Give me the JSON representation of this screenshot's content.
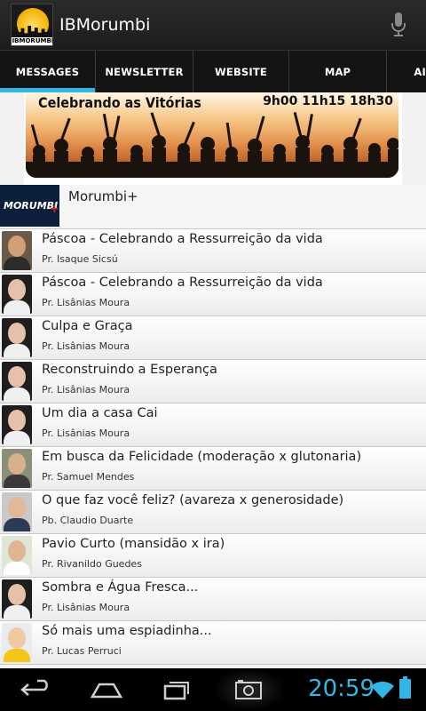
{
  "app": {
    "title": "IBMorumbi",
    "logo_text": "IBMORUMBI"
  },
  "tabs": [
    {
      "label": "MESSAGES",
      "active": true
    },
    {
      "label": "NEWSLETTER",
      "active": false
    },
    {
      "label": "WEBSITE",
      "active": false
    },
    {
      "label": "MAP",
      "active": false
    },
    {
      "label": "AI",
      "active": false
    }
  ],
  "banner": {
    "title": "Celebrando as Vitórias",
    "times": "9h00 11h15 18h30"
  },
  "featured": {
    "label": "Morumbi+",
    "thumb_text": "MORUMBI",
    "thumb_plus": "+"
  },
  "messages": [
    {
      "title": "Páscoa - Celebrando a Ressurreição da vida",
      "speaker": "Pr. Isaque Sicsú"
    },
    {
      "title": "Páscoa - Celebrando a Ressurreição da vida",
      "speaker": "Pr. Lisânias Moura"
    },
    {
      "title": "Culpa e Graça",
      "speaker": "Pr. Lisânias Moura"
    },
    {
      "title": "Reconstruindo a Esperança",
      "speaker": "Pr. Lisânias Moura"
    },
    {
      "title": "Um dia a casa Cai",
      "speaker": "Pr. Lisânias Moura"
    },
    {
      "title": "Em busca da Felicidade (moderação x glutonaria)",
      "speaker": "Pr. Samuel Mendes"
    },
    {
      "title": "O que faz você feliz? (avareza x generosidade)",
      "speaker": "Pb. Claudio Duarte"
    },
    {
      "title": "Pavio Curto (mansidão x ira)",
      "speaker": "Pr. Rivanildo Guedes"
    },
    {
      "title": "Sombra e Água Fresca...",
      "speaker": "Pr. Lisânias Moura"
    },
    {
      "title": "Só mais uma espiadinha...",
      "speaker": "Pr. Lucas Perruci"
    }
  ],
  "status": {
    "clock": "20:59"
  },
  "colors": {
    "accent": "#33b5e5",
    "action_bar": "#222222",
    "tab_bar": "#141414"
  }
}
